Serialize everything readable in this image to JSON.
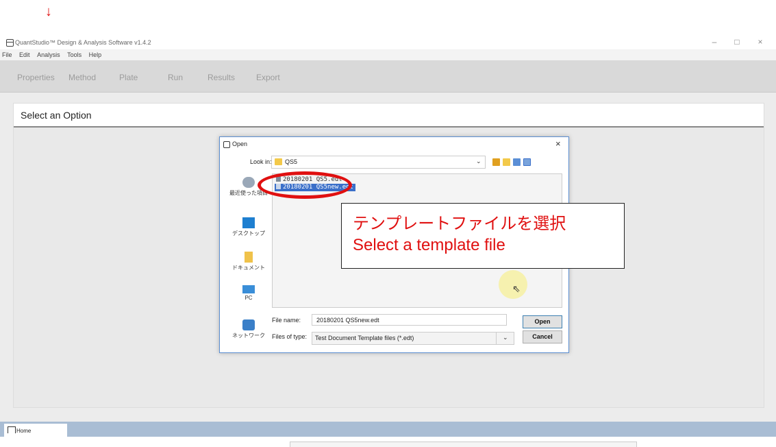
{
  "annotation": {
    "arrow": "↓"
  },
  "window": {
    "title": "QuantStudio™ Design & Analysis Software v1.4.2",
    "minimize": "–",
    "maximize": "□",
    "close": "×"
  },
  "menu": [
    "File",
    "Edit",
    "Analysis",
    "Tools",
    "Help"
  ],
  "nav_tabs": [
    "Properties",
    "Method",
    "Plate",
    "Run",
    "Results",
    "Export"
  ],
  "panel": {
    "title": "Select an Option"
  },
  "dialog": {
    "title": "Open",
    "close": "×",
    "look_in_label": "Look in:",
    "look_in_value": "QS5",
    "places": [
      {
        "label": "最近使った項目",
        "icon": "recent-places-icon"
      },
      {
        "label": "デスクトップ",
        "icon": "desktop-icon"
      },
      {
        "label": "ドキュメント",
        "icon": "documents-icon"
      },
      {
        "label": "PC",
        "icon": "pc-icon"
      },
      {
        "label": "ネットワーク",
        "icon": "network-icon"
      }
    ],
    "files": [
      {
        "name": "20180201 QS5.edt",
        "selected": false
      },
      {
        "name": "20180201 QS5new.edt",
        "selected": true
      }
    ],
    "file_name_label": "File name:",
    "file_name_value": "20180201 QS5new.edt",
    "files_of_type_label": "Files of type:",
    "files_of_type_value": "Test Document Template files (*.edt)",
    "open_button": "Open",
    "cancel_button": "Cancel"
  },
  "callout": {
    "line1": "テンプレートファイルを選択",
    "line2": "Select a template file"
  },
  "bottom_tab": {
    "label": "Home"
  },
  "colors": {
    "annotation_red": "#e01010",
    "selection_blue": "#3a6fc9",
    "tabbar": "#a9bdd4"
  }
}
